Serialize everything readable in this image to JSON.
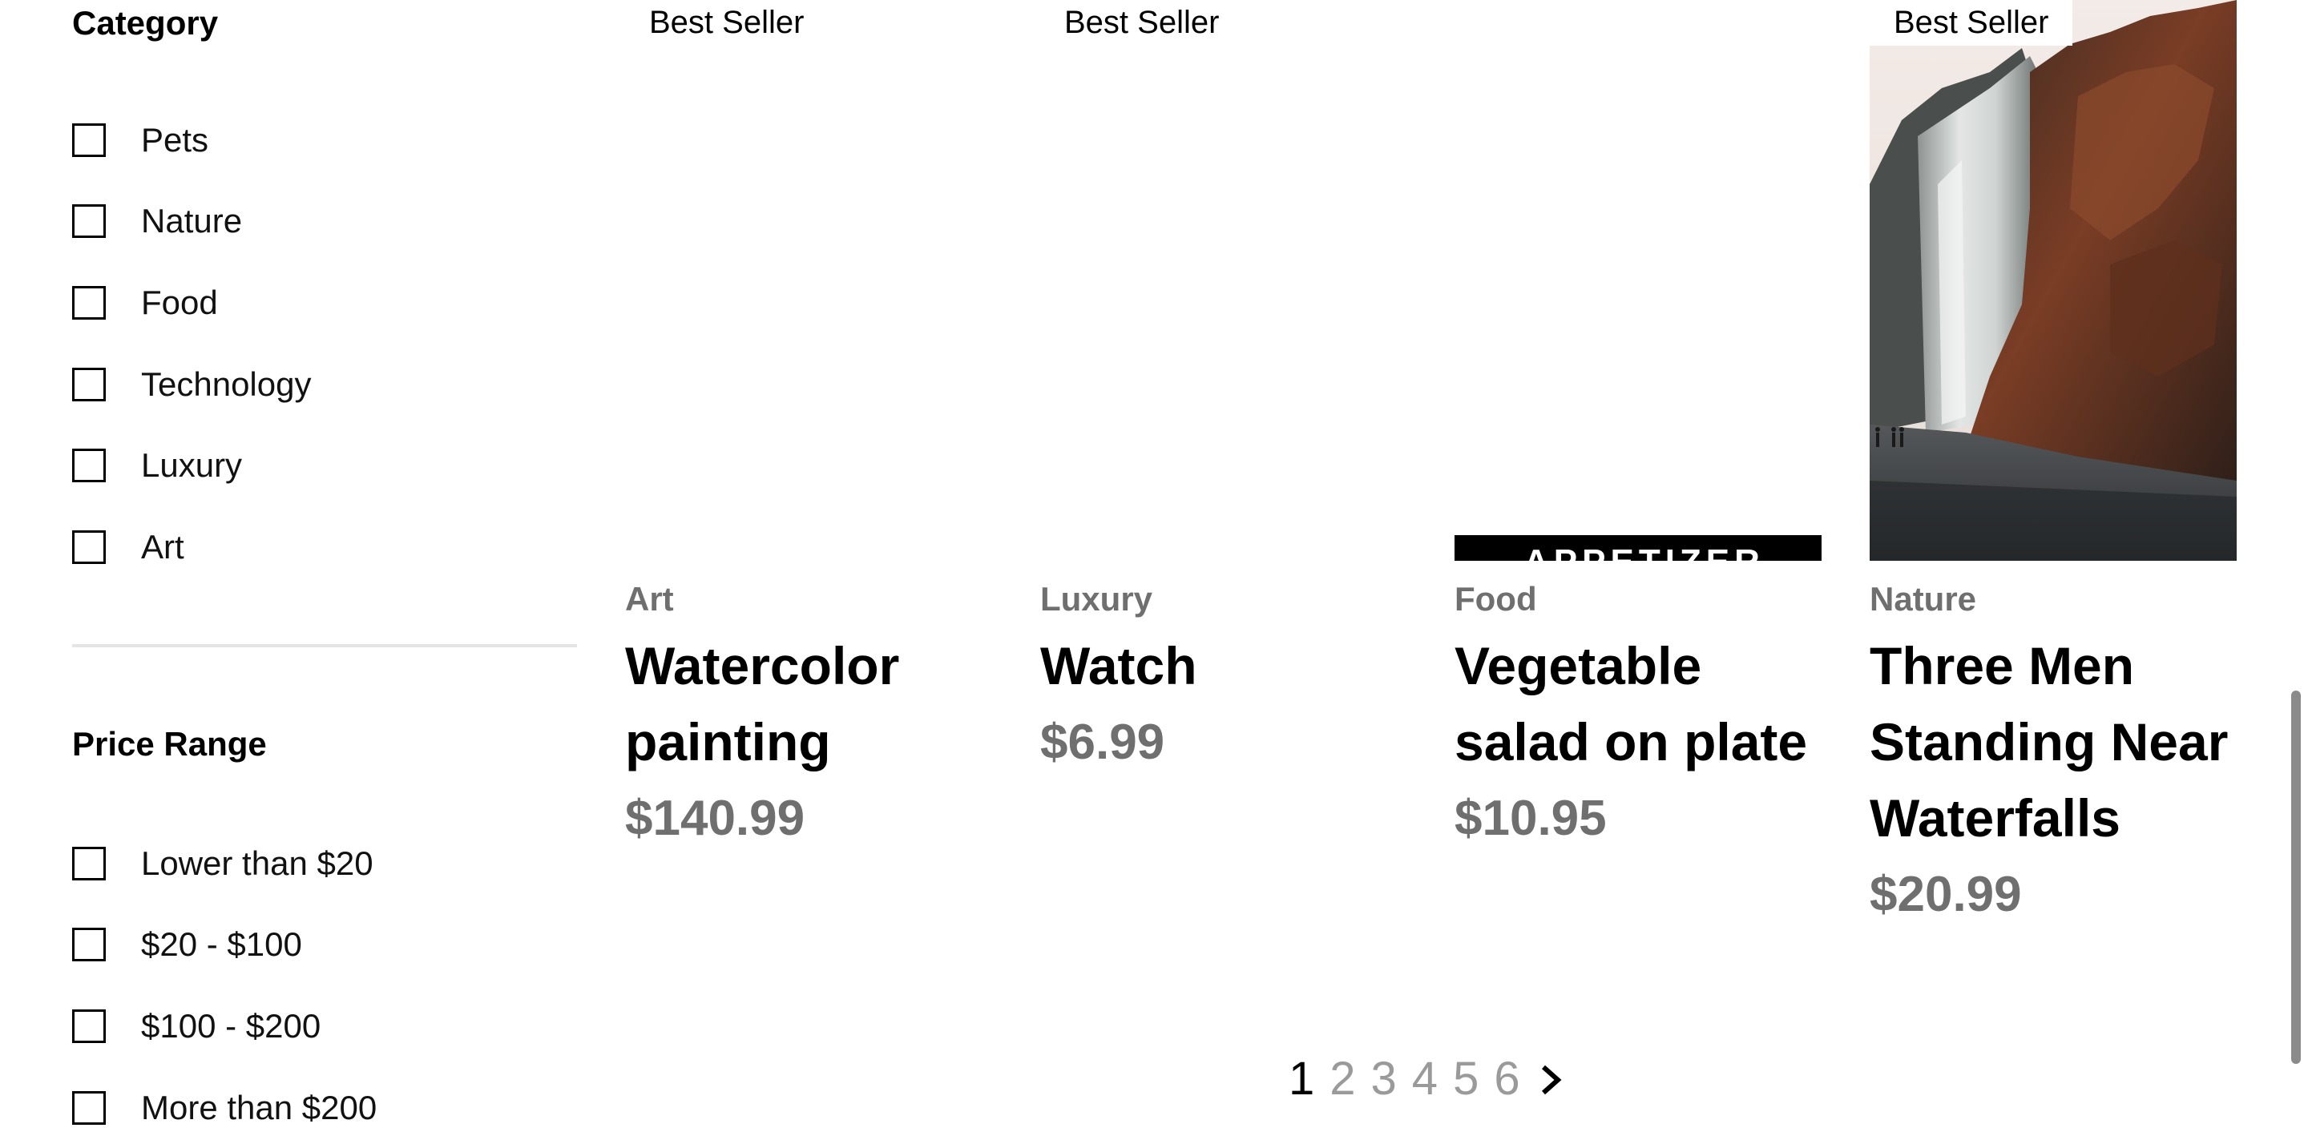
{
  "filters": {
    "category": {
      "title": "Category",
      "items": [
        {
          "label": "Pets",
          "checked": false
        },
        {
          "label": "Nature",
          "checked": false
        },
        {
          "label": "Food",
          "checked": false
        },
        {
          "label": "Technology",
          "checked": false
        },
        {
          "label": "Luxury",
          "checked": false
        },
        {
          "label": "Art",
          "checked": false
        }
      ]
    },
    "price": {
      "title": "Price Range",
      "items": [
        {
          "label": "Lower than $20",
          "checked": false
        },
        {
          "label": "$20 - $100",
          "checked": false
        },
        {
          "label": "$100 - $200",
          "checked": false
        },
        {
          "label": "More than $200",
          "checked": false
        }
      ]
    }
  },
  "products": [
    {
      "badge": "Best Seller",
      "category": "Art",
      "title": "Watercolor painting",
      "price": "$140.99",
      "image": "none"
    },
    {
      "badge": "Best Seller",
      "category": "Luxury",
      "title": "Watch",
      "price": "$6.99",
      "image": "none"
    },
    {
      "badge": "",
      "category": "Food",
      "title": "Vegetable salad on plate",
      "price": "$10.95",
      "image": "salad-photo-strip",
      "image_text": "APPETIZER"
    },
    {
      "badge": "Best Seller",
      "category": "Nature",
      "title": "Three Men Standing Near Waterfalls",
      "price": "$20.99",
      "image": "waterfall-photo"
    }
  ],
  "pagination": {
    "pages": [
      "1",
      "2",
      "3",
      "4",
      "5",
      "6"
    ],
    "current": "1",
    "next_icon": "chevron-right-icon"
  },
  "colors": {
    "muted_text": "#6f6f6f",
    "divider": "#e4e4e4",
    "scrollbar_thumb": "#8b8b8b"
  }
}
